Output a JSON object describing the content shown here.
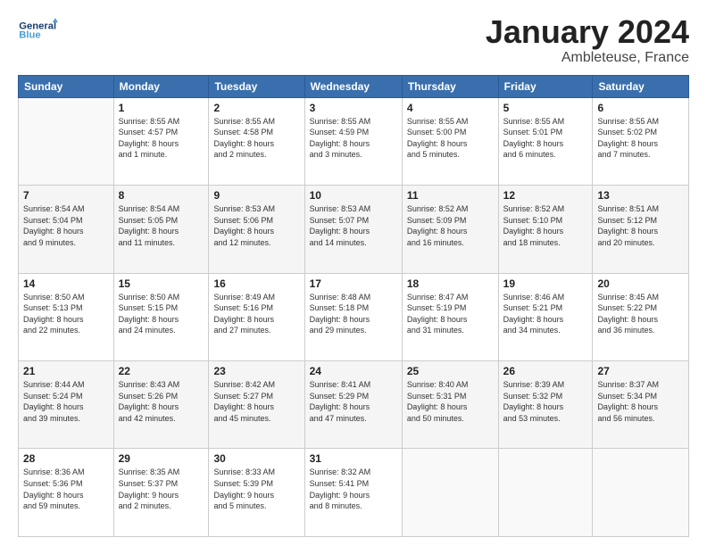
{
  "header": {
    "logo": {
      "line1": "General",
      "line2": "Blue"
    },
    "title": "January 2024",
    "location": "Ambleteuse, France"
  },
  "columns": [
    "Sunday",
    "Monday",
    "Tuesday",
    "Wednesday",
    "Thursday",
    "Friday",
    "Saturday"
  ],
  "weeks": [
    [
      {
        "day": "",
        "info": ""
      },
      {
        "day": "1",
        "info": "Sunrise: 8:55 AM\nSunset: 4:57 PM\nDaylight: 8 hours\nand 1 minute."
      },
      {
        "day": "2",
        "info": "Sunrise: 8:55 AM\nSunset: 4:58 PM\nDaylight: 8 hours\nand 2 minutes."
      },
      {
        "day": "3",
        "info": "Sunrise: 8:55 AM\nSunset: 4:59 PM\nDaylight: 8 hours\nand 3 minutes."
      },
      {
        "day": "4",
        "info": "Sunrise: 8:55 AM\nSunset: 5:00 PM\nDaylight: 8 hours\nand 5 minutes."
      },
      {
        "day": "5",
        "info": "Sunrise: 8:55 AM\nSunset: 5:01 PM\nDaylight: 8 hours\nand 6 minutes."
      },
      {
        "day": "6",
        "info": "Sunrise: 8:55 AM\nSunset: 5:02 PM\nDaylight: 8 hours\nand 7 minutes."
      }
    ],
    [
      {
        "day": "7",
        "info": "Sunrise: 8:54 AM\nSunset: 5:04 PM\nDaylight: 8 hours\nand 9 minutes."
      },
      {
        "day": "8",
        "info": "Sunrise: 8:54 AM\nSunset: 5:05 PM\nDaylight: 8 hours\nand 11 minutes."
      },
      {
        "day": "9",
        "info": "Sunrise: 8:53 AM\nSunset: 5:06 PM\nDaylight: 8 hours\nand 12 minutes."
      },
      {
        "day": "10",
        "info": "Sunrise: 8:53 AM\nSunset: 5:07 PM\nDaylight: 8 hours\nand 14 minutes."
      },
      {
        "day": "11",
        "info": "Sunrise: 8:52 AM\nSunset: 5:09 PM\nDaylight: 8 hours\nand 16 minutes."
      },
      {
        "day": "12",
        "info": "Sunrise: 8:52 AM\nSunset: 5:10 PM\nDaylight: 8 hours\nand 18 minutes."
      },
      {
        "day": "13",
        "info": "Sunrise: 8:51 AM\nSunset: 5:12 PM\nDaylight: 8 hours\nand 20 minutes."
      }
    ],
    [
      {
        "day": "14",
        "info": "Sunrise: 8:50 AM\nSunset: 5:13 PM\nDaylight: 8 hours\nand 22 minutes."
      },
      {
        "day": "15",
        "info": "Sunrise: 8:50 AM\nSunset: 5:15 PM\nDaylight: 8 hours\nand 24 minutes."
      },
      {
        "day": "16",
        "info": "Sunrise: 8:49 AM\nSunset: 5:16 PM\nDaylight: 8 hours\nand 27 minutes."
      },
      {
        "day": "17",
        "info": "Sunrise: 8:48 AM\nSunset: 5:18 PM\nDaylight: 8 hours\nand 29 minutes."
      },
      {
        "day": "18",
        "info": "Sunrise: 8:47 AM\nSunset: 5:19 PM\nDaylight: 8 hours\nand 31 minutes."
      },
      {
        "day": "19",
        "info": "Sunrise: 8:46 AM\nSunset: 5:21 PM\nDaylight: 8 hours\nand 34 minutes."
      },
      {
        "day": "20",
        "info": "Sunrise: 8:45 AM\nSunset: 5:22 PM\nDaylight: 8 hours\nand 36 minutes."
      }
    ],
    [
      {
        "day": "21",
        "info": "Sunrise: 8:44 AM\nSunset: 5:24 PM\nDaylight: 8 hours\nand 39 minutes."
      },
      {
        "day": "22",
        "info": "Sunrise: 8:43 AM\nSunset: 5:26 PM\nDaylight: 8 hours\nand 42 minutes."
      },
      {
        "day": "23",
        "info": "Sunrise: 8:42 AM\nSunset: 5:27 PM\nDaylight: 8 hours\nand 45 minutes."
      },
      {
        "day": "24",
        "info": "Sunrise: 8:41 AM\nSunset: 5:29 PM\nDaylight: 8 hours\nand 47 minutes."
      },
      {
        "day": "25",
        "info": "Sunrise: 8:40 AM\nSunset: 5:31 PM\nDaylight: 8 hours\nand 50 minutes."
      },
      {
        "day": "26",
        "info": "Sunrise: 8:39 AM\nSunset: 5:32 PM\nDaylight: 8 hours\nand 53 minutes."
      },
      {
        "day": "27",
        "info": "Sunrise: 8:37 AM\nSunset: 5:34 PM\nDaylight: 8 hours\nand 56 minutes."
      }
    ],
    [
      {
        "day": "28",
        "info": "Sunrise: 8:36 AM\nSunset: 5:36 PM\nDaylight: 8 hours\nand 59 minutes."
      },
      {
        "day": "29",
        "info": "Sunrise: 8:35 AM\nSunset: 5:37 PM\nDaylight: 9 hours\nand 2 minutes."
      },
      {
        "day": "30",
        "info": "Sunrise: 8:33 AM\nSunset: 5:39 PM\nDaylight: 9 hours\nand 5 minutes."
      },
      {
        "day": "31",
        "info": "Sunrise: 8:32 AM\nSunset: 5:41 PM\nDaylight: 9 hours\nand 8 minutes."
      },
      {
        "day": "",
        "info": ""
      },
      {
        "day": "",
        "info": ""
      },
      {
        "day": "",
        "info": ""
      }
    ]
  ]
}
